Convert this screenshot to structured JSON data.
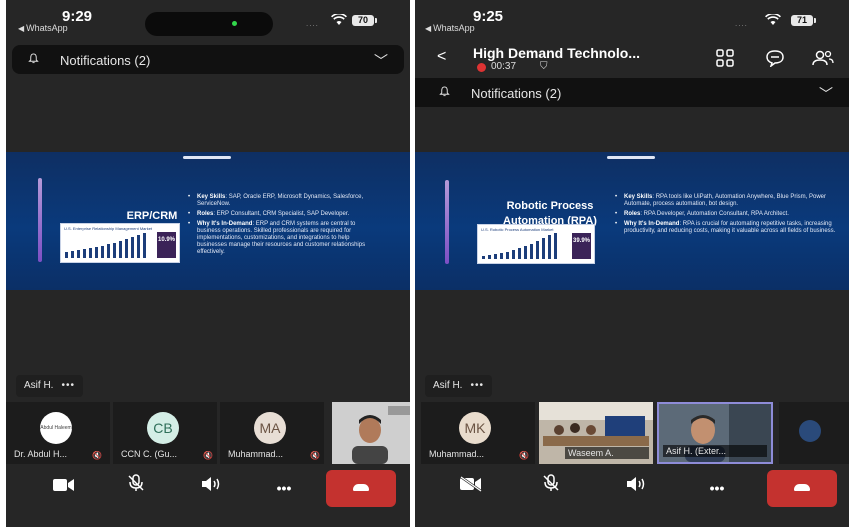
{
  "left": {
    "status": {
      "time": "9:29",
      "back_app": "WhatsApp",
      "signal": "....",
      "battery": "70"
    },
    "notifications": "Notifications (2)",
    "slide": {
      "title": "ERP/CRM",
      "chart_caption": "U.S. Enterprise Relationship Management Market",
      "chart_stat": "10.9%",
      "bullets": [
        {
          "label": "Key Skills",
          "text": ": SAP, Oracle ERP, Microsoft Dynamics, Salesforce, ServiceNow."
        },
        {
          "label": "Roles",
          "text": ": ERP Consultant, CRM Specialist, SAP Developer."
        },
        {
          "label": "Why It's In-Demand",
          "text": ": ERP and CRM systems are central to business operations. Skilled professionals are required for implementations, customizations, and integrations to help businesses manage their resources and customer relationships effectively."
        }
      ]
    },
    "speaker": {
      "name": "Asif H.",
      "more": "•••"
    },
    "participants": [
      {
        "initials": "Abdul Haleem",
        "name": "Dr. Abdul H..."
      },
      {
        "initials": "CB",
        "name": "CCN C. (Gu..."
      },
      {
        "initials": "MA",
        "name": "Muhammad..."
      },
      {
        "initials": "",
        "name": ""
      }
    ]
  },
  "right": {
    "status": {
      "time": "9:25",
      "back_app": "WhatsApp",
      "signal": "....",
      "battery": "71"
    },
    "call": {
      "title": "High Demand Technolo...",
      "duration": "00:37"
    },
    "notifications": "Notifications (2)",
    "slide": {
      "title": "Robotic Process Automation (RPA)",
      "chart_caption": "U.S. Robotic Process Automation Market",
      "chart_stat": "39.9%",
      "bullets": [
        {
          "label": "Key Skills",
          "text": ": RPA tools like UiPath, Automation Anywhere, Blue Prism, Power Automate, process automation, bot design."
        },
        {
          "label": "Roles",
          "text": ": RPA Developer, Automation Consultant, RPA Architect."
        },
        {
          "label": "Why It's In-Demand",
          "text": ": RPA is crucial for automating repetitive tasks, increasing productivity, and reducing costs, making it valuable across all fields of business."
        }
      ]
    },
    "speaker": {
      "name": "Asif H.",
      "more": "•••"
    },
    "participants": [
      {
        "initials": "MK",
        "name": "Muhammad..."
      },
      {
        "initials": "",
        "name": "Waseem A."
      },
      {
        "initials": "",
        "name": "Asif H. (Exter..."
      },
      {
        "initials": "",
        "name": ""
      }
    ]
  },
  "colors": {
    "background": "#262626",
    "end_call": "#c4322f",
    "slide": "#0a3a7c",
    "accent": "#8e8cd8"
  }
}
